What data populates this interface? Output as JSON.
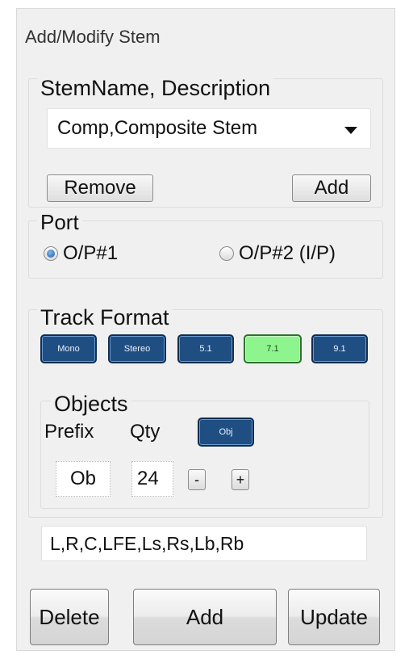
{
  "panel": {
    "title": "Add/Modify Stem"
  },
  "stem": {
    "group_label": "StemName, Description",
    "selected": "Comp,Composite Stem",
    "remove_label": "Remove",
    "add_label": "Add"
  },
  "port": {
    "group_label": "Port",
    "options": [
      {
        "label": "O/P#1",
        "checked": true
      },
      {
        "label": "O/P#2 (I/P)",
        "checked": false
      }
    ]
  },
  "track_format": {
    "group_label": "Track Format",
    "buttons": [
      "Mono",
      "Stereo",
      "5.1",
      "7.1",
      "9.1"
    ],
    "active": "7.1",
    "active_color": "#8ef58e",
    "button_color": "#1f4f82"
  },
  "objects": {
    "group_label": "Objects",
    "prefix_label": "Prefix",
    "qty_label": "Qty",
    "obj_button": "Obj",
    "prefix_value": "Ob",
    "qty_value": "24",
    "minus": "-",
    "plus": "+"
  },
  "channels": {
    "value": "L,R,C,LFE,Ls,Rs,Lb,Rb"
  },
  "actions": {
    "delete": "Delete",
    "add": "Add",
    "update": "Update"
  }
}
